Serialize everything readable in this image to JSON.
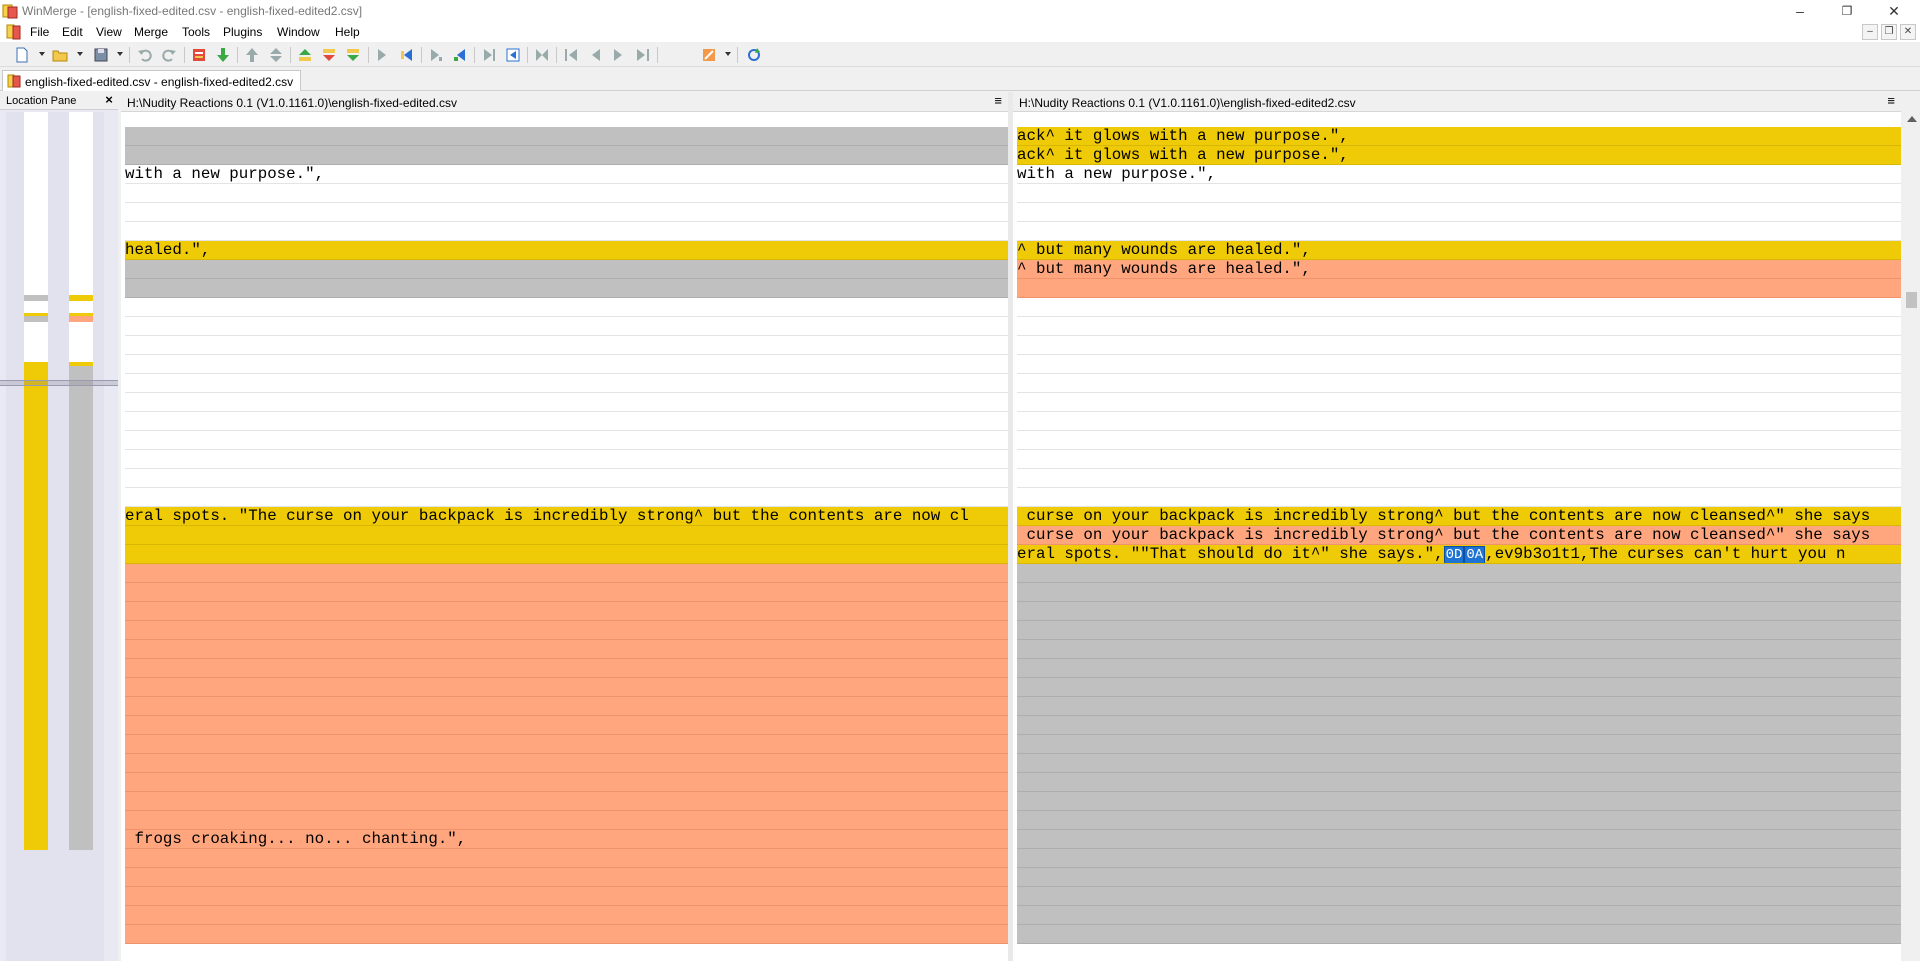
{
  "window": {
    "title": "WinMerge - [english-fixed-edited.csv - english-fixed-edited2.csv]",
    "minimize_glyph": "–",
    "restore_glyph": "❐",
    "close_glyph": "✕"
  },
  "menubar": {
    "items": [
      "File",
      "Edit",
      "View",
      "Merge",
      "Tools",
      "Plugins",
      "Window",
      "Help"
    ],
    "mdi_minimize": "–",
    "mdi_restore": "❐",
    "mdi_close": "✕"
  },
  "toolbar": {
    "icons": [
      "new-document-icon",
      "open-folder-icon",
      "save-icon",
      "undo-icon",
      "redo-icon",
      "refresh-icon",
      "prev-diff-icon",
      "next-diff-icon",
      "first-diff-icon",
      "last-diff-icon",
      "current-diff-icon",
      "copy-left-icon",
      "copy-right-icon",
      "copy-left-advance-icon",
      "copy-right-advance-icon",
      "all-left-icon",
      "all-right-icon",
      "first-conflict-icon",
      "prev-conflict-icon",
      "next-conflict-icon",
      "last-conflict-icon",
      "options-icon",
      "rescan-icon"
    ]
  },
  "tab": {
    "label": "english-fixed-edited.csv - english-fixed-edited2.csv"
  },
  "location_pane": {
    "title": "Location Pane",
    "close_glyph": "×"
  },
  "left_pane": {
    "path": "H:\\Nudity Reactions 0.1 (V1.0.1161.0)\\english-fixed-edited.csv",
    "menu_glyph": "≡",
    "lines": [
      {
        "text": "",
        "type": "blank"
      },
      {
        "text": "",
        "type": "removed"
      },
      {
        "text": "",
        "type": "removed"
      },
      {
        "text": "with a new purpose.\",",
        "type": "normal"
      },
      {
        "text": "",
        "type": "normal"
      },
      {
        "text": "",
        "type": "normal"
      },
      {
        "text": "",
        "type": "normal"
      },
      {
        "text": "healed.\",",
        "type": "changed"
      },
      {
        "text": "",
        "type": "removed"
      },
      {
        "text": "",
        "type": "removed"
      },
      {
        "text": "",
        "type": "normal"
      },
      {
        "text": "",
        "type": "normal"
      },
      {
        "text": "",
        "type": "normal"
      },
      {
        "text": "",
        "type": "normal"
      },
      {
        "text": "",
        "type": "normal"
      },
      {
        "text": "",
        "type": "normal"
      },
      {
        "text": "",
        "type": "normal"
      },
      {
        "text": "",
        "type": "normal"
      },
      {
        "text": "",
        "type": "normal"
      },
      {
        "text": "",
        "type": "normal"
      },
      {
        "text": "",
        "type": "normal"
      },
      {
        "text": "eral spots. \"The curse on your backpack is incredibly strong^ but the contents are now cl",
        "type": "changed"
      },
      {
        "text": "",
        "type": "changed"
      },
      {
        "text": "",
        "type": "changed"
      },
      {
        "text": "",
        "type": "moved"
      },
      {
        "text": "",
        "type": "moved"
      },
      {
        "text": "",
        "type": "moved"
      },
      {
        "text": "",
        "type": "moved"
      },
      {
        "text": "",
        "type": "moved"
      },
      {
        "text": "",
        "type": "moved"
      },
      {
        "text": "",
        "type": "moved"
      },
      {
        "text": "",
        "type": "moved"
      },
      {
        "text": "",
        "type": "moved"
      },
      {
        "text": "",
        "type": "moved"
      },
      {
        "text": "",
        "type": "moved"
      },
      {
        "text": "",
        "type": "moved"
      },
      {
        "text": "",
        "type": "moved"
      },
      {
        "text": "",
        "type": "moved"
      },
      {
        "text": " frogs croaking... no... chanting.\",",
        "type": "moved"
      },
      {
        "text": "",
        "type": "moved"
      },
      {
        "text": "",
        "type": "moved"
      },
      {
        "text": "",
        "type": "moved"
      },
      {
        "text": "",
        "type": "moved"
      },
      {
        "text": "",
        "type": "moved"
      }
    ]
  },
  "right_pane": {
    "path": "H:\\Nudity Reactions 0.1 (V1.0.1161.0)\\english-fixed-edited2.csv",
    "menu_glyph": "≡",
    "lines": [
      {
        "text": "",
        "type": "blank"
      },
      {
        "text": "ack^ it glows with a new purpose.\",",
        "type": "changed"
      },
      {
        "text": "ack^ it glows with a new purpose.\",",
        "type": "changed"
      },
      {
        "text": "with a new purpose.\",",
        "type": "normal"
      },
      {
        "text": "",
        "type": "normal"
      },
      {
        "text": "",
        "type": "normal"
      },
      {
        "text": "",
        "type": "normal"
      },
      {
        "text": "^ but many wounds are healed.\",",
        "type": "changed"
      },
      {
        "text": "^ but many wounds are healed.\",",
        "type": "moved"
      },
      {
        "text": "",
        "type": "moved"
      },
      {
        "text": "",
        "type": "normal"
      },
      {
        "text": "",
        "type": "normal"
      },
      {
        "text": "",
        "type": "normal"
      },
      {
        "text": "",
        "type": "normal"
      },
      {
        "text": "",
        "type": "normal"
      },
      {
        "text": "",
        "type": "normal"
      },
      {
        "text": "",
        "type": "normal"
      },
      {
        "text": "",
        "type": "normal"
      },
      {
        "text": "",
        "type": "normal"
      },
      {
        "text": "",
        "type": "normal"
      },
      {
        "text": "",
        "type": "normal"
      },
      {
        "text": " curse on your backpack is incredibly strong^ but the contents are now cleansed^\" she says",
        "type": "changed"
      },
      {
        "text": " curse on your backpack is incredibly strong^ but the contents are now cleansed^\" she says",
        "type": "moved"
      },
      {
        "text": "eral spots. \"\"That should do it^\" she says.\",",
        "type": "changed",
        "eol_cr": "0D",
        "eol_lf": "0A",
        "after": ",ev9b3o1t1,The curses can't hurt you n"
      },
      {
        "text": "",
        "type": "removed"
      },
      {
        "text": "",
        "type": "removed"
      },
      {
        "text": "",
        "type": "removed"
      },
      {
        "text": "",
        "type": "removed"
      },
      {
        "text": "",
        "type": "removed"
      },
      {
        "text": "",
        "type": "removed"
      },
      {
        "text": "",
        "type": "removed"
      },
      {
        "text": "",
        "type": "removed"
      },
      {
        "text": "",
        "type": "removed"
      },
      {
        "text": "",
        "type": "removed"
      },
      {
        "text": "",
        "type": "removed"
      },
      {
        "text": "",
        "type": "removed"
      },
      {
        "text": "",
        "type": "removed"
      },
      {
        "text": "",
        "type": "removed"
      },
      {
        "text": "",
        "type": "removed"
      },
      {
        "text": "",
        "type": "removed"
      },
      {
        "text": "",
        "type": "removed"
      },
      {
        "text": "",
        "type": "removed"
      },
      {
        "text": "",
        "type": "removed"
      },
      {
        "text": "",
        "type": "removed"
      }
    ]
  },
  "colors": {
    "changed": "#efca06",
    "removed": "#c0c0c0",
    "moved": "#ffa67e",
    "eol_marker": "#1f74d3"
  }
}
